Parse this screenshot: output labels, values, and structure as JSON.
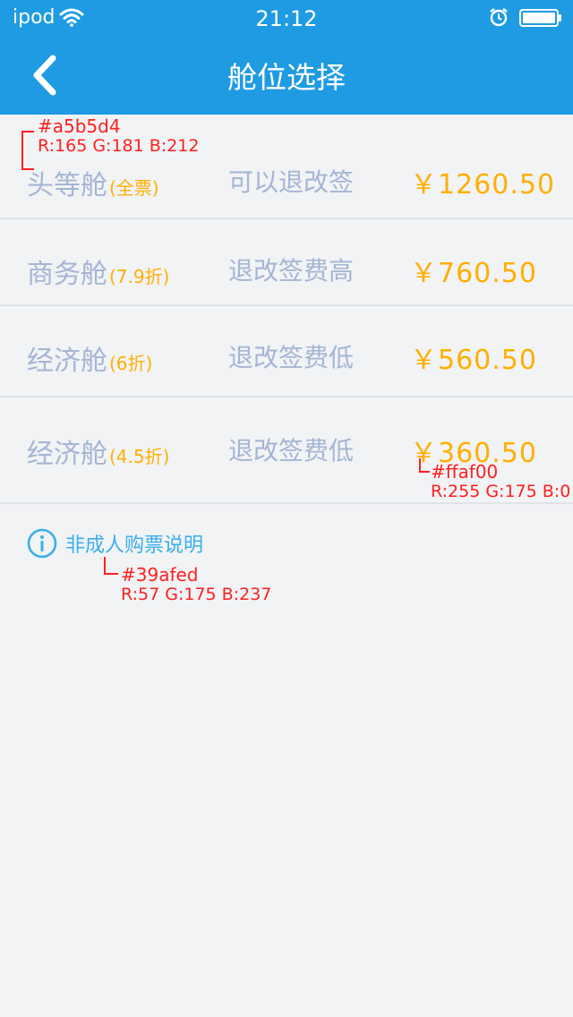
{
  "status_bar": {
    "carrier": "ipod",
    "time": "21:12"
  },
  "header": {
    "title": "舱位选择",
    "back_icon": "chevron-left-icon"
  },
  "cabins": [
    {
      "name": "头等舱",
      "discount": "(全票)",
      "policy": "可以退改签",
      "price": "￥1260.50"
    },
    {
      "name": "商务舱",
      "discount": "(7.9折)",
      "policy": "退改签费高",
      "price": "￥760.50"
    },
    {
      "name": "经济舱",
      "discount": "(6折)",
      "policy": "退改签费低",
      "price": "￥560.50"
    },
    {
      "name": "经济舱",
      "discount": "(4.5折)",
      "policy": "退改签费低",
      "price": "￥360.50"
    }
  ],
  "child_ticket_link": {
    "icon": "info-icon",
    "label": "非成人购票说明"
  },
  "annotations": {
    "cabin_text_color": {
      "hex": "#a5b5d4",
      "rgb": "R:165 G:181 B:212"
    },
    "price_color": {
      "hex": "#ffaf00",
      "rgb": "R:255 G:175 B:0"
    },
    "link_color": {
      "hex": "#39afed",
      "rgb": "R:57 G:175 B:237"
    }
  },
  "colors": {
    "header_bg": "#1e9be2",
    "page_bg": "#f1f3f5",
    "cabin_text": "#a5b5d4",
    "price": "#ffaf00",
    "link": "#39afed",
    "annotation": "#ff2020"
  }
}
